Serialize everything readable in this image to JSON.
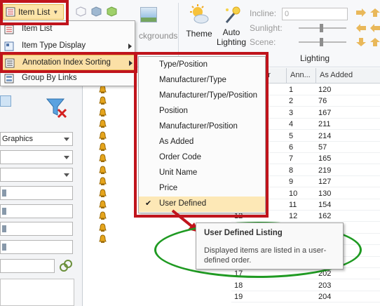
{
  "ribbon": {
    "item_list_label": "Item List",
    "backgrounds_label": "ckgrounds",
    "theme_label": "Theme",
    "auto_lighting_line1": "Auto",
    "auto_lighting_line2": "Lighting",
    "incline_label": "Incline:",
    "incline_value": "0",
    "sunlight_label": "Sunlight:",
    "scene_label": "Scene:",
    "lighting_group_label": "Lighting"
  },
  "left_pane": {
    "graphics_dropdown": "Graphics"
  },
  "item_menu": {
    "items": [
      {
        "label": "Item List",
        "icon": "list-icon",
        "has_submenu": false,
        "highlighted": false
      },
      {
        "label": "Item Type Display",
        "icon": "item-type-icon",
        "has_submenu": true,
        "highlighted": false
      },
      {
        "label": "Annotation Index Sorting",
        "icon": "sort-icon",
        "has_submenu": true,
        "highlighted": true
      },
      {
        "label": "Group By Links",
        "icon": "group-links-icon",
        "has_submenu": false,
        "highlighted": false
      }
    ]
  },
  "sorting_menu": {
    "items": [
      {
        "label": "Type/Position",
        "checked": false
      },
      {
        "label": "Manufacturer/Type",
        "checked": false
      },
      {
        "label": "Manufacturer/Type/Position",
        "checked": false
      },
      {
        "label": "Position",
        "checked": false
      },
      {
        "label": "Manufacturer/Position",
        "checked": false
      },
      {
        "label": "As Added",
        "checked": false
      },
      {
        "label": "Order Code",
        "checked": false
      },
      {
        "label": "Unit Name",
        "checked": false
      },
      {
        "label": "Price",
        "checked": false
      },
      {
        "label": "User Defined",
        "checked": true
      }
    ],
    "checkmark": "✔"
  },
  "grid": {
    "columns": [
      "ber",
      "Ann...",
      "As Added"
    ],
    "rows": [
      {
        "num": "",
        "ann": "1",
        "added": "120"
      },
      {
        "num": "",
        "ann": "2",
        "added": "76"
      },
      {
        "num": "",
        "ann": "3",
        "added": "167"
      },
      {
        "num": "",
        "ann": "4",
        "added": "211"
      },
      {
        "num": "",
        "ann": "5",
        "added": "214"
      },
      {
        "num": "",
        "ann": "6",
        "added": "57"
      },
      {
        "num": "",
        "ann": "7",
        "added": "165"
      },
      {
        "num": "",
        "ann": "8",
        "added": "219"
      },
      {
        "num": "",
        "ann": "9",
        "added": "127"
      },
      {
        "num": "",
        "ann": "10",
        "added": "130"
      },
      {
        "num": "",
        "ann": "11",
        "added": "154"
      },
      {
        "num": "12",
        "ann": "12",
        "added": "162"
      },
      {
        "num": "",
        "ann": "",
        "added": ""
      },
      {
        "num": "",
        "ann": "",
        "added": ""
      },
      {
        "num": "",
        "ann": "",
        "added": ""
      },
      {
        "num": "",
        "ann": "",
        "added": ""
      },
      {
        "num": "17",
        "ann": "",
        "added": "202"
      },
      {
        "num": "18",
        "ann": "",
        "added": "203"
      },
      {
        "num": "19",
        "ann": "",
        "added": "204"
      }
    ]
  },
  "tooltip": {
    "title": "User Defined Listing",
    "body": "Displayed items are listed in a user-defined order."
  },
  "colors": {
    "highlight_red": "#c0141c",
    "annotation_green": "#1f9a22",
    "menu_hover": "#fde8b6"
  }
}
